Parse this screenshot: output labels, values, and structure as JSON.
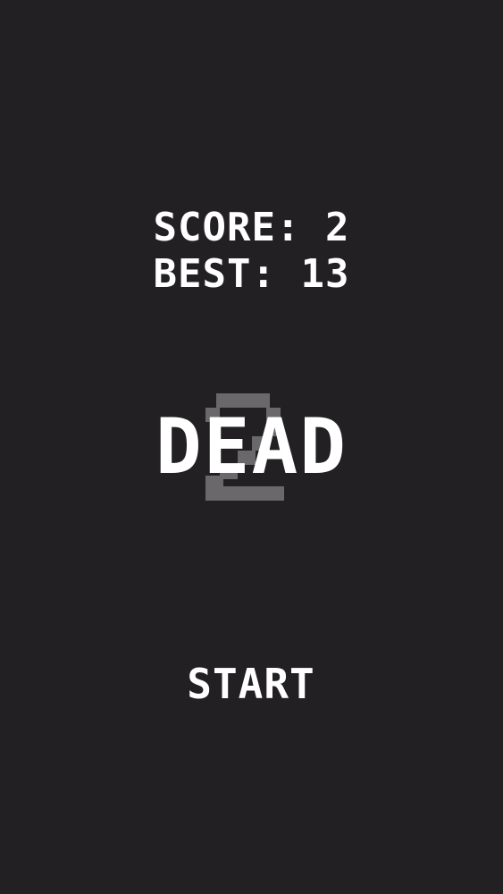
{
  "game": {
    "score_text": "SCORE: 2",
    "best_text": "BEST: 13",
    "status_text": "DEAD",
    "background_digit": "2",
    "start_label": "START"
  },
  "colors": {
    "background": "#222023",
    "text": "#ffffff",
    "ghost_digit": "#6a686b"
  }
}
